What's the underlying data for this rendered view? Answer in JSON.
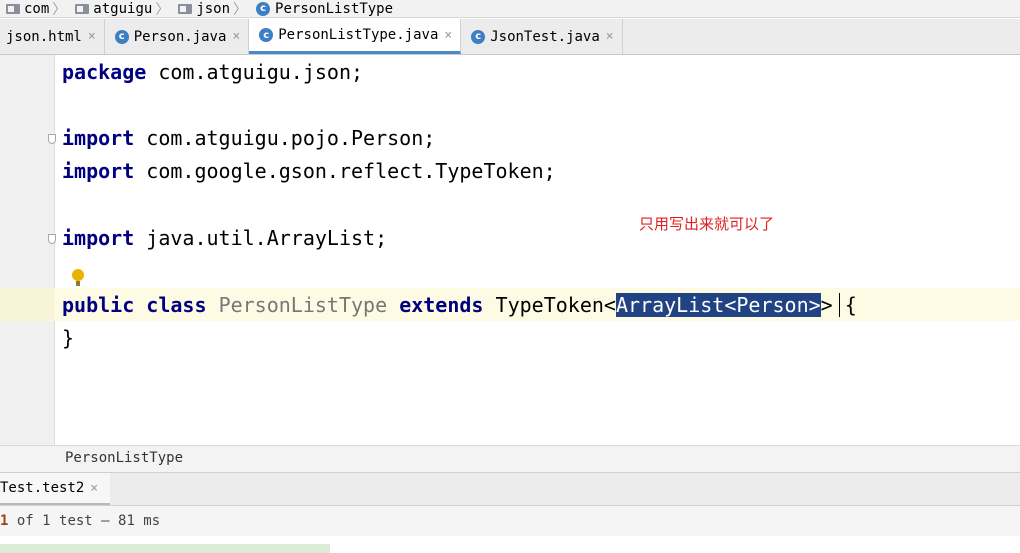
{
  "breadcrumb": [
    {
      "label": "com",
      "icon": "folder-icon"
    },
    {
      "label": "atguigu",
      "icon": "folder-icon"
    },
    {
      "label": "json",
      "icon": "folder-icon"
    },
    {
      "label": "PersonListType",
      "icon": "class-icon"
    }
  ],
  "class_icon_glyph": "c",
  "tabs": [
    {
      "label": "json.html",
      "icon": "html-icon",
      "active": false
    },
    {
      "label": "Person.java",
      "icon": "class-icon",
      "active": false
    },
    {
      "label": "PersonListType.java",
      "icon": "class-icon",
      "active": true
    },
    {
      "label": "JsonTest.java",
      "icon": "class-icon",
      "active": false
    }
  ],
  "tab_close_glyph": "×",
  "code": {
    "line1": {
      "kw": "package",
      "rest": " com.atguigu.json;"
    },
    "line3": {
      "kw": "import",
      "rest": " com.atguigu.pojo.Person;"
    },
    "line4": {
      "kw": "import",
      "rest": " com.google.gson.reflect.TypeToken;"
    },
    "line6": {
      "kw": "import",
      "rest": " java.util.ArrayList;"
    },
    "line8": {
      "kw1": "public",
      "kw2": "class",
      "class_name": "PersonListType",
      "kw3": "extends",
      "type1": "TypeToken<",
      "selection": "ArrayList<Person>",
      "tail": "> {"
    },
    "line9": "}"
  },
  "annotation": "只用写出来就可以了",
  "structure": {
    "label": "PersonListType"
  },
  "run": {
    "tab_label": "Test.test2",
    "status_count": "1",
    "status_text": " of 1 test – 81 ms"
  },
  "colors": {
    "keyword": "#000080",
    "selection_bg": "#214283",
    "annotation": "#e02020",
    "active_tab_underline": "#4a88c7"
  }
}
